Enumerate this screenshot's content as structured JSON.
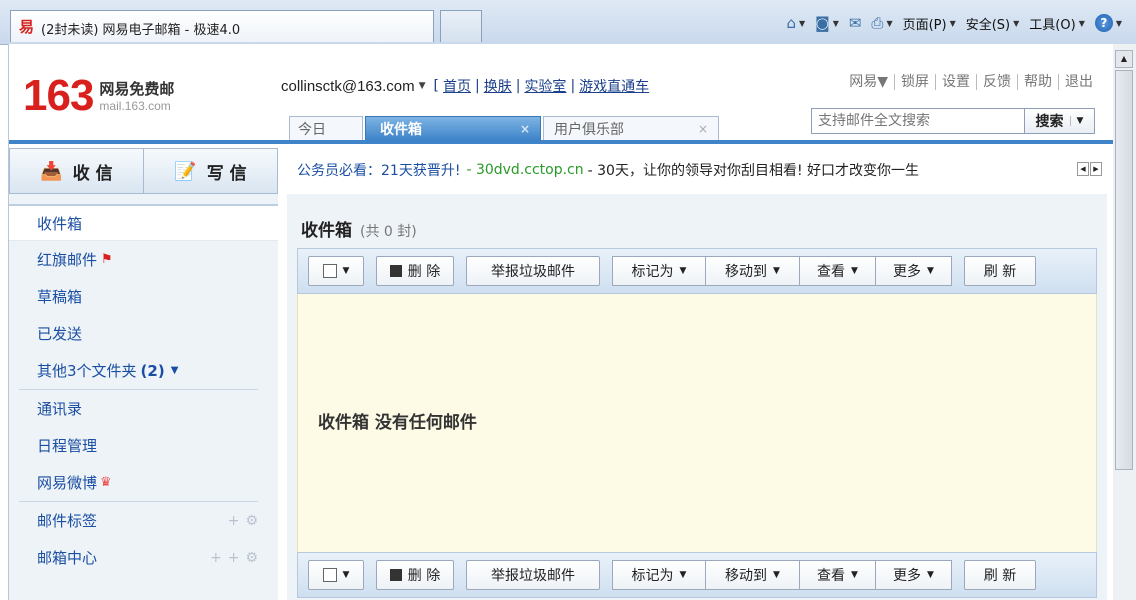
{
  "browser": {
    "tab_title": "(2封未读) 网易电子邮箱 - 极速4.0",
    "tools": {
      "home": "",
      "page": "页面(P)",
      "safety": "安全(S)",
      "tools": "工具(O)",
      "help": "?"
    }
  },
  "header": {
    "logo_number": "163",
    "logo_title": "网易免费邮",
    "logo_domain": "mail.163.com",
    "account_email": "collinsctk@163.com",
    "account_links": [
      "首页",
      "换肤",
      "实验室",
      "游戏直通车"
    ],
    "top_links": [
      "网易▼",
      "锁屏",
      "设置",
      "反馈",
      "帮助",
      "退出"
    ],
    "search": {
      "placeholder": "支持邮件全文搜索",
      "button_label": "搜索"
    },
    "tabs": [
      {
        "label": "今日"
      },
      {
        "label": "收件箱",
        "close": "×"
      },
      {
        "label": "用户俱乐部",
        "close": "×"
      }
    ]
  },
  "sidebar": {
    "receive_label": "收 信",
    "compose_label": "写 信",
    "items": [
      {
        "label": "收件箱"
      },
      {
        "label": "红旗邮件"
      },
      {
        "label": "草稿箱"
      },
      {
        "label": "已发送"
      },
      {
        "label": "其他3个文件夹",
        "badge": "(2)"
      },
      {
        "label": "通讯录"
      },
      {
        "label": "日程管理"
      },
      {
        "label": "网易微博"
      },
      {
        "label": "邮件标签"
      },
      {
        "label": "邮箱中心"
      }
    ]
  },
  "ad": {
    "text1": "公务员必看：21天获晋升!",
    "text2": "- 30dvd.cctop.cn",
    "text3": "- 30天，让你的领导对你刮目相看!  好口才改变你一生"
  },
  "main": {
    "title": "收件箱",
    "count": "(共 0 封)",
    "empty_message": "收件箱 没有任何邮件",
    "toolbar": {
      "delete": "删 除",
      "report_spam": "举报垃圾邮件",
      "mark_as": "标记为",
      "move_to": "移动到",
      "view": "查看",
      "more": "更多",
      "refresh": "刷 新"
    }
  },
  "colors": {
    "brand_red": "#d8211c",
    "tab_blue": "#3f84c9",
    "empty_bg": "#fdfbe5"
  }
}
